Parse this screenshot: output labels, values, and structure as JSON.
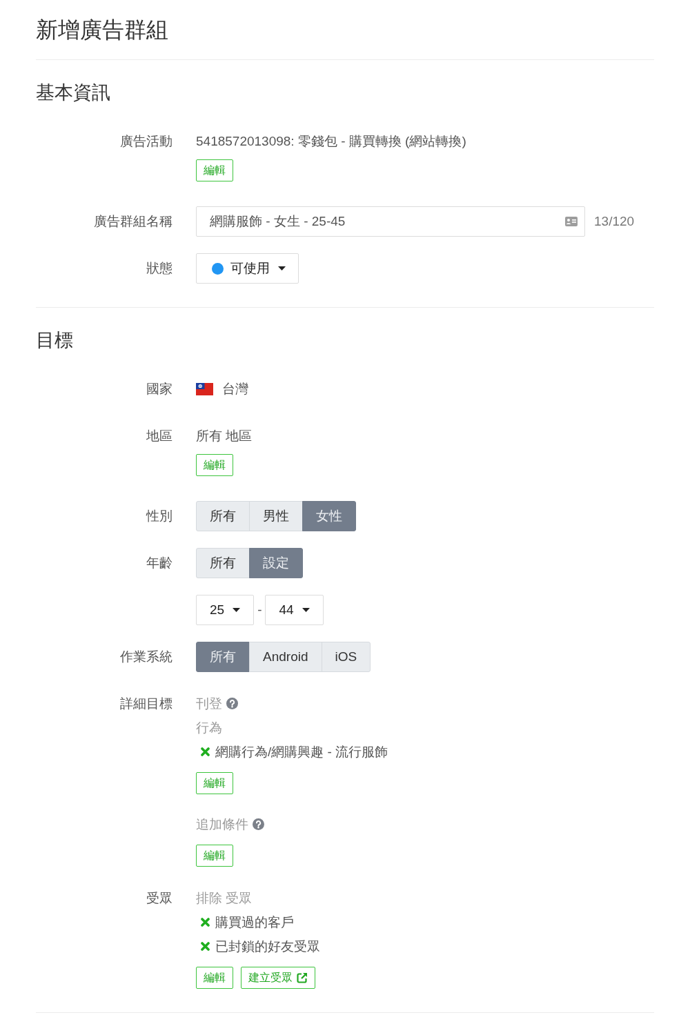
{
  "page": {
    "title": "新增廣告群組"
  },
  "sections": [
    {
      "heading": "基本資訊",
      "fields": [
        {
          "kind": "text",
          "label": "廣告活動",
          "value": "5418572013098: 零錢包 - 購買轉換 (網站轉換)",
          "buttons": [
            {
              "kind": "edit",
              "label": "編輯"
            }
          ]
        },
        {
          "kind": "input",
          "label": "廣告群組名稱",
          "value": "網購服飾 - 女生 - 25-45",
          "counter": "13/120"
        },
        {
          "kind": "status",
          "label": "狀態",
          "value": "可使用",
          "color": "#2196f3"
        }
      ]
    },
    {
      "heading": "目標",
      "fields": [
        {
          "kind": "country",
          "label": "國家",
          "value": "台灣"
        },
        {
          "kind": "text",
          "label": "地區",
          "value": "所有 地區",
          "buttons": [
            {
              "kind": "edit",
              "label": "編輯"
            }
          ]
        },
        {
          "kind": "segmented",
          "label": "性別",
          "options": [
            {
              "label": "所有",
              "selected": false
            },
            {
              "label": "男性",
              "selected": false
            },
            {
              "label": "女性",
              "selected": true
            }
          ]
        },
        {
          "kind": "segmented",
          "label": "年齡",
          "options": [
            {
              "label": "所有",
              "selected": false
            },
            {
              "label": "設定",
              "selected": true
            }
          ]
        },
        {
          "kind": "range",
          "from": "25",
          "separator": "-",
          "to": "44"
        },
        {
          "kind": "segmented",
          "label": "作業系統",
          "options": [
            {
              "label": "所有",
              "selected": true
            },
            {
              "label": "Android",
              "selected": false
            },
            {
              "label": "iOS",
              "selected": false
            }
          ]
        },
        {
          "kind": "groups",
          "label": "詳細目標",
          "groups": [
            {
              "title": "刊登",
              "help": true,
              "subtitle": "行為",
              "items": [
                "網購行為/網購興趣 - 流行服飾"
              ],
              "buttons": [
                {
                  "kind": "edit",
                  "label": "編輯"
                }
              ]
            },
            {
              "title": "追加條件",
              "help": true,
              "buttons": [
                {
                  "kind": "edit",
                  "label": "編輯"
                }
              ]
            }
          ]
        },
        {
          "kind": "groups",
          "label": "受眾",
          "groups": [
            {
              "title": "排除 受眾",
              "items": [
                "購買過的客戶",
                "已封鎖的好友受眾"
              ],
              "buttons": [
                {
                  "kind": "edit",
                  "label": "編輯"
                },
                {
                  "kind": "external",
                  "label": "建立受眾"
                }
              ]
            }
          ]
        }
      ]
    }
  ]
}
